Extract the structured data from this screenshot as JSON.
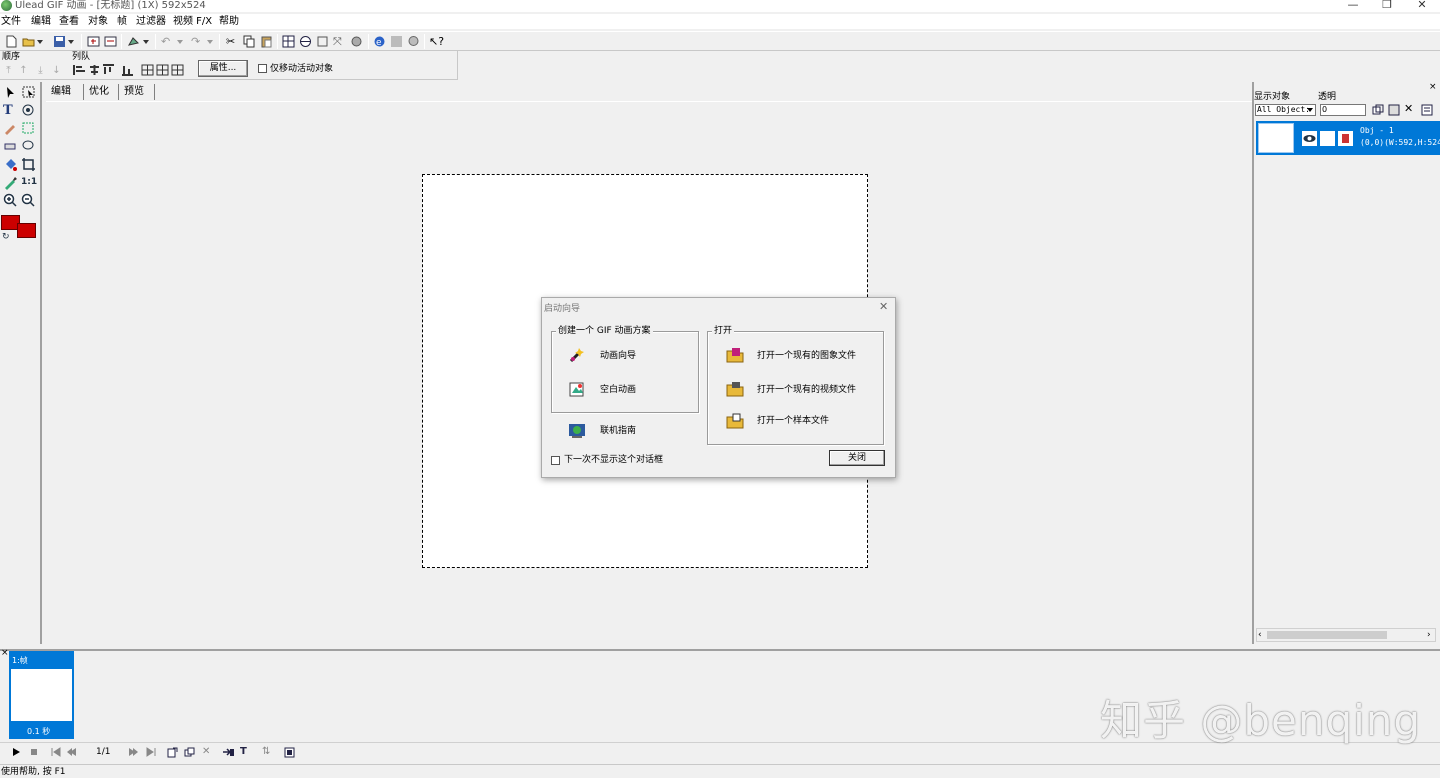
{
  "window": {
    "title": "Ulead GIF 动画 - [无标题] (1X) 592x524",
    "minimize": "—",
    "restore": "❐",
    "close": "✕"
  },
  "menu": [
    "文件",
    "编辑",
    "查看",
    "对象",
    "帧",
    "过滤器",
    "视频 F/X",
    "帮助"
  ],
  "toolbar2": {
    "order_label": "顺序",
    "queue_label": "列队",
    "properties_button": "属性...",
    "move_active_only": "仅移动活动对象"
  },
  "tabs": [
    "编辑",
    "优化",
    "预览"
  ],
  "right_panel": {
    "show_objects_label": "显示对象",
    "transparency_label": "透明",
    "object_filter": "All Object:",
    "transparency_value": "0",
    "object_name": "Obj - 1",
    "object_info": "(0,0)(W:592,H:524"
  },
  "frames": [
    {
      "label": "1:帧",
      "delay": "0.1 秒"
    }
  ],
  "playback": {
    "counter": "1/1"
  },
  "status": "使用帮助, 按 F1",
  "dialog": {
    "title": "启动向导",
    "create_group": "创建一个 GIF 动画方案",
    "animation_wizard": "动画向导",
    "blank_animation": "空白动画",
    "online_guide": "联机指南",
    "open_group": "打开",
    "open_image": "打开一个现有的图象文件",
    "open_video": "打开一个现有的视频文件",
    "open_sample": "打开一个样本文件",
    "dont_show": "下一次不显示这个对话框",
    "close_button": "关闭"
  },
  "colors": {
    "foreground": "#cc0000",
    "background": "#cc0000",
    "selection": "#0078d7"
  },
  "watermark": "知乎 @benqing"
}
